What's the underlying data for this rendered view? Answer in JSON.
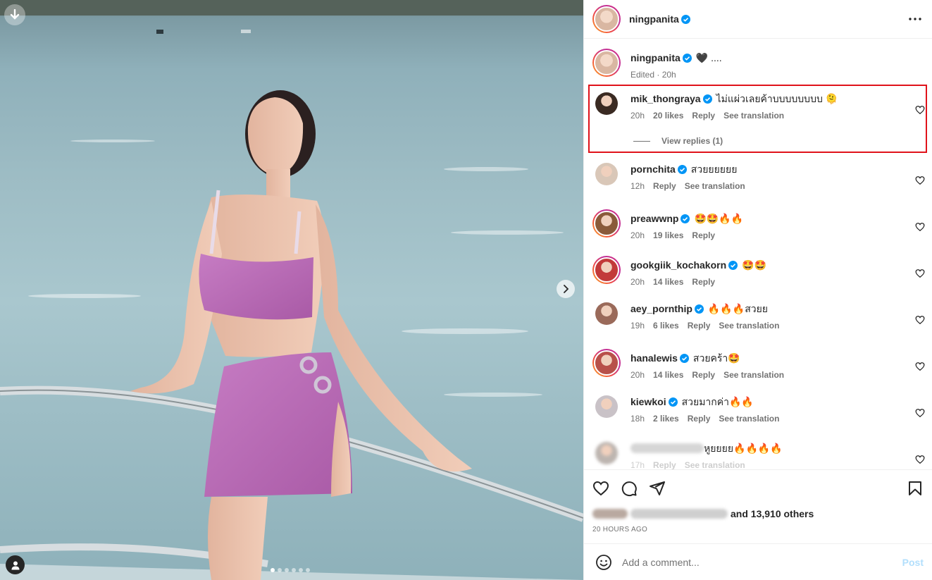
{
  "post": {
    "author": "ningpanita",
    "caption": "🖤 ....",
    "caption_meta": "Edited · 20h",
    "image_count": 6,
    "active_image": 1
  },
  "comments": [
    {
      "user": "mik_thongraya",
      "verified": true,
      "text": "ไม่แผ่วเลยค้าบบบบบบบบ 🫠",
      "time": "20h",
      "likes": "20 likes",
      "reply": "Reply",
      "translate": "See translation",
      "view_replies": "View replies (1)",
      "highlighted": true,
      "avatar_color": "#3a2a22"
    },
    {
      "user": "pornchita",
      "verified": true,
      "text": "สวยยยยยย",
      "time": "12h",
      "likes": "",
      "reply": "Reply",
      "translate": "See translation",
      "avatar_color": "#d9c7b8"
    },
    {
      "user": "preawwnp",
      "verified": true,
      "text": "🤩🤩🔥🔥",
      "time": "20h",
      "likes": "19 likes",
      "reply": "Reply",
      "translate": "",
      "ring": true,
      "avatar_color": "#8a5a3a"
    },
    {
      "user": "gookgiik_kochakorn",
      "verified": true,
      "text": "🤩🤩",
      "time": "20h",
      "likes": "14 likes",
      "reply": "Reply",
      "translate": "",
      "ring": true,
      "avatar_color": "#c23a3a"
    },
    {
      "user": "aey_pornthip",
      "verified": true,
      "text": "🔥🔥🔥สวยย",
      "time": "19h",
      "likes": "6 likes",
      "reply": "Reply",
      "translate": "See translation",
      "avatar_color": "#9a6a5a"
    },
    {
      "user": "hanalewis",
      "verified": true,
      "text": "สวยคร้า🤩",
      "time": "20h",
      "likes": "14 likes",
      "reply": "Reply",
      "translate": "See translation",
      "ring": true,
      "avatar_color": "#b8504a"
    },
    {
      "user": "kiewkoi",
      "verified": true,
      "text": "สวยมากค่า🔥🔥",
      "time": "18h",
      "likes": "2 likes",
      "reply": "Reply",
      "translate": "See translation",
      "avatar_color": "#c9c2c7"
    },
    {
      "user": "",
      "verified": false,
      "text": "หูยยยย🔥🔥🔥🔥",
      "time": "17h",
      "likes": "",
      "reply": "Reply",
      "translate": "See translation",
      "blurred": true,
      "avatar_color": "#bdb5b0"
    }
  ],
  "footer": {
    "likes_others": "and 13,910 others",
    "timestamp": "20 HOURS AGO",
    "comment_placeholder": "Add a comment...",
    "post_label": "Post"
  },
  "colors": {
    "highlight": "#e0121a",
    "verified": "#0095f6",
    "post_disabled": "#b2dffc"
  }
}
